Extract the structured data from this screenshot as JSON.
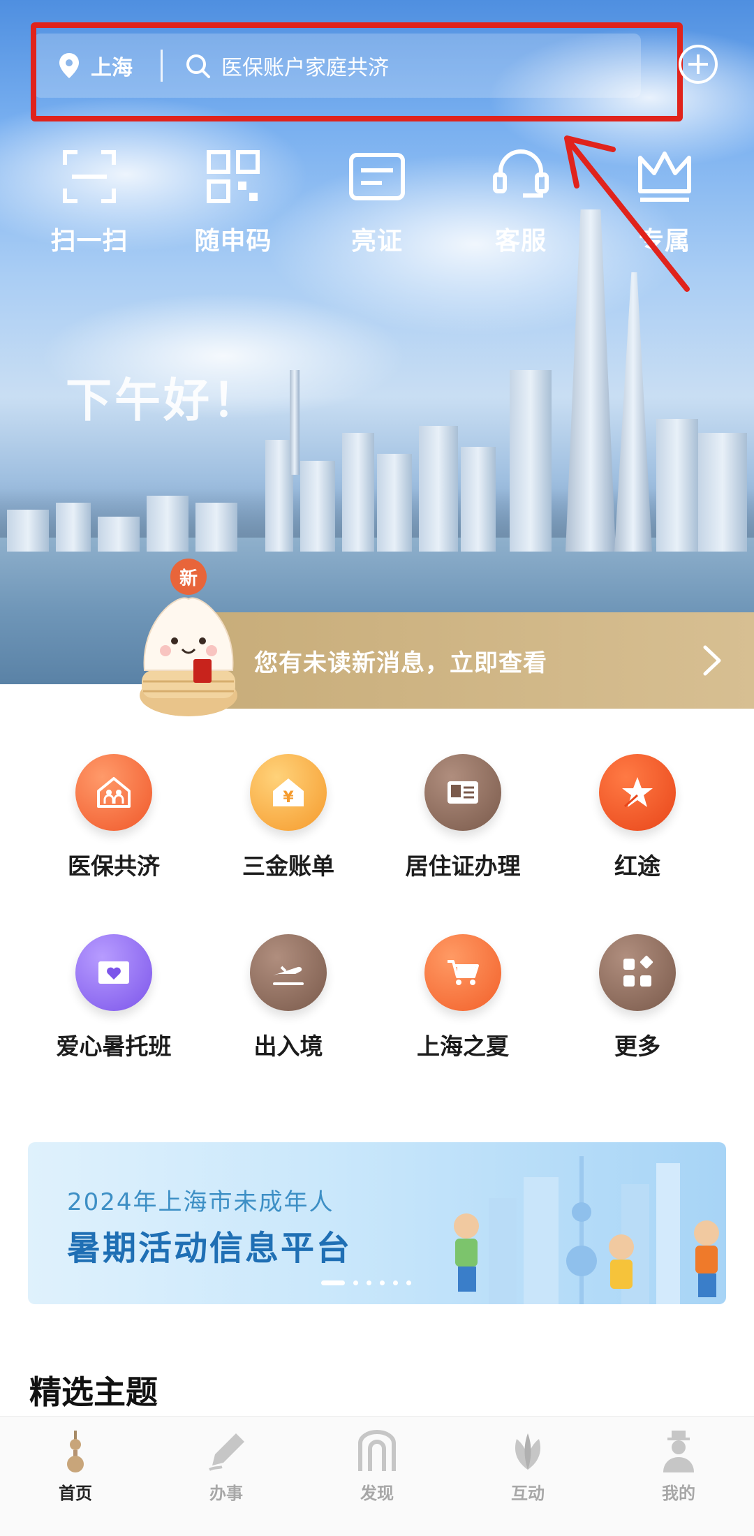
{
  "search": {
    "location": "上海",
    "placeholder": "医保账户家庭共济"
  },
  "quick_actions": [
    {
      "icon": "scan-icon",
      "label": "扫一扫"
    },
    {
      "icon": "qr-code-icon",
      "label": "随申码"
    },
    {
      "icon": "id-card-icon",
      "label": "亮证"
    },
    {
      "icon": "customer-service-icon",
      "label": "客服"
    },
    {
      "icon": "crown-icon",
      "label": "专属"
    }
  ],
  "greeting": "下午好！",
  "notice": {
    "badge": "新",
    "text": "您有未读新消息，立即查看"
  },
  "services": [
    {
      "icon": "family-home-icon",
      "label": "医保共济",
      "color": "#f26a3c"
    },
    {
      "icon": "yen-house-icon",
      "label": "三金账单",
      "color": "#f8a53a"
    },
    {
      "icon": "residence-card-icon",
      "label": "居住证办理",
      "color": "#8d6a5a"
    },
    {
      "icon": "star-icon",
      "label": "红途",
      "color": "#f05a24"
    },
    {
      "icon": "heart-book-icon",
      "label": "爱心暑托班",
      "color": "#8e6cf0"
    },
    {
      "icon": "plane-icon",
      "label": "出入境",
      "color": "#8a6a5c"
    },
    {
      "icon": "cart-icon",
      "label": "上海之夏",
      "color": "#f4743a"
    },
    {
      "icon": "grid-more-icon",
      "label": "更多",
      "color": "#8a6a5c"
    }
  ],
  "promo": {
    "line1": "2024年上海市未成年人",
    "line2": "暑期活动信息平台"
  },
  "section_title": "精选主题",
  "tabs": [
    {
      "icon": "tower-icon",
      "label": "首页",
      "active": true
    },
    {
      "icon": "pen-icon",
      "label": "办事",
      "active": false
    },
    {
      "icon": "arch-icon",
      "label": "发现",
      "active": false
    },
    {
      "icon": "magnolia-icon",
      "label": "互动",
      "active": false
    },
    {
      "icon": "person-icon",
      "label": "我的",
      "active": false
    }
  ]
}
